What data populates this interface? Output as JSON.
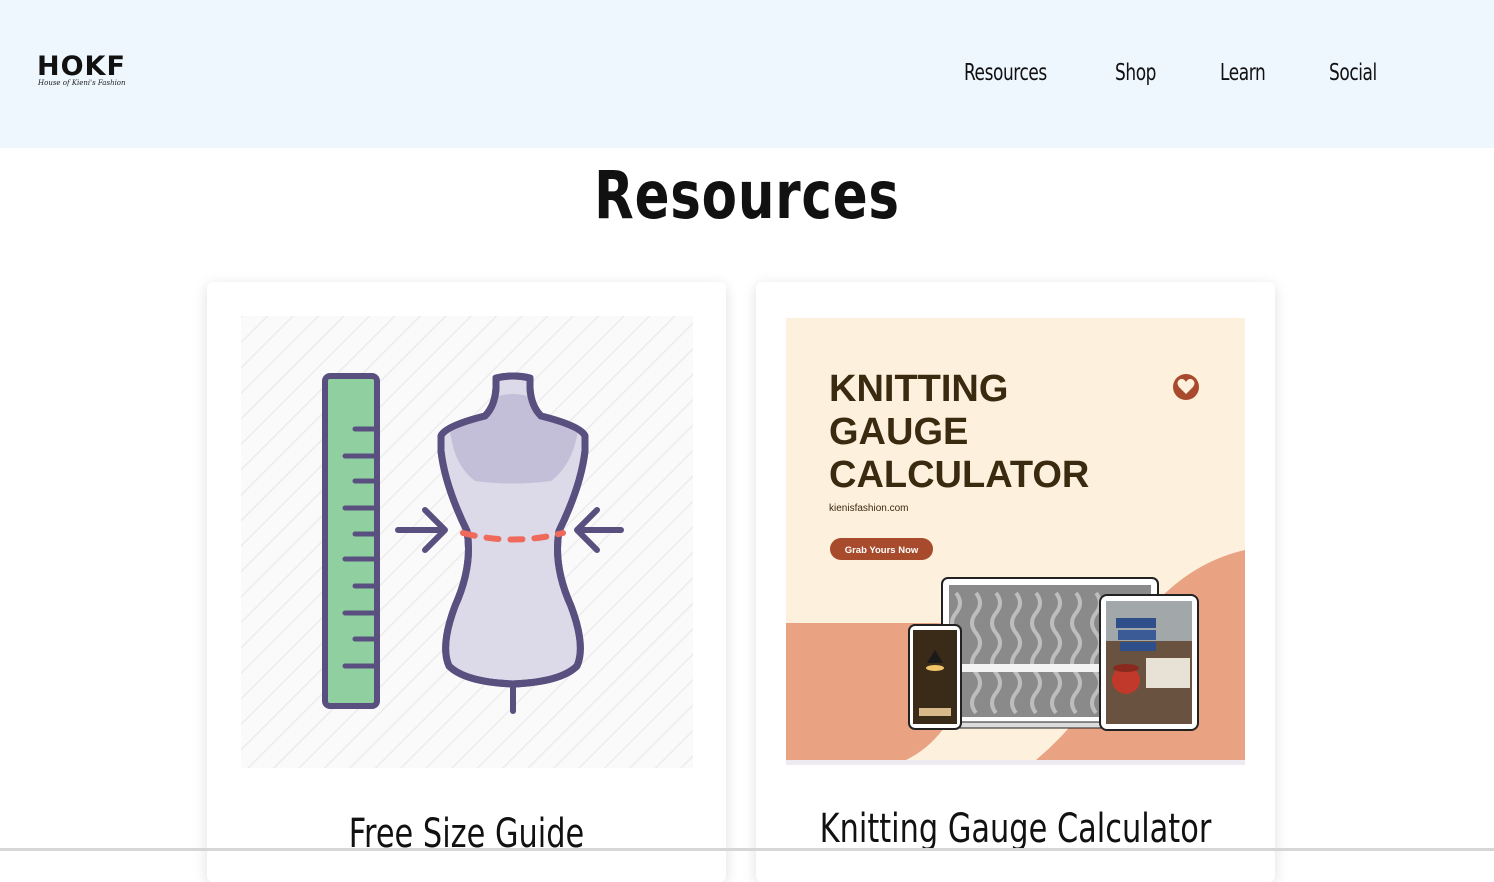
{
  "header": {
    "logo": {
      "mark": "HOKF",
      "subtitle": "House of Kieni's Fashion"
    },
    "nav": [
      {
        "label": "Resources"
      },
      {
        "label": "Shop"
      },
      {
        "label": "Learn"
      },
      {
        "label": "Social"
      }
    ]
  },
  "page": {
    "title": "Resources"
  },
  "cards": [
    {
      "title": "Free Size Guide",
      "image_icon": "dress-form-ruler-icon"
    },
    {
      "title": "Knitting Gauge Calculator",
      "image_icon": "knitting-gauge-promo-image",
      "promo": {
        "heading_line1": "KNITTING",
        "heading_line2": "GAUGE",
        "heading_line3": "CALCULATOR",
        "website": "kienisfashion.com",
        "cta": "Grab Yours Now"
      }
    }
  ],
  "colors": {
    "header_bg": "#eef6fe",
    "ruler_green": "#8fcfa0",
    "outline_purple": "#5a5080",
    "waist_red": "#ef6a5a",
    "promo_bg": "#fdf0dc",
    "promo_accent": "#e9a383",
    "promo_brand": "#a84a2c",
    "promo_heading": "#3a2a10"
  }
}
